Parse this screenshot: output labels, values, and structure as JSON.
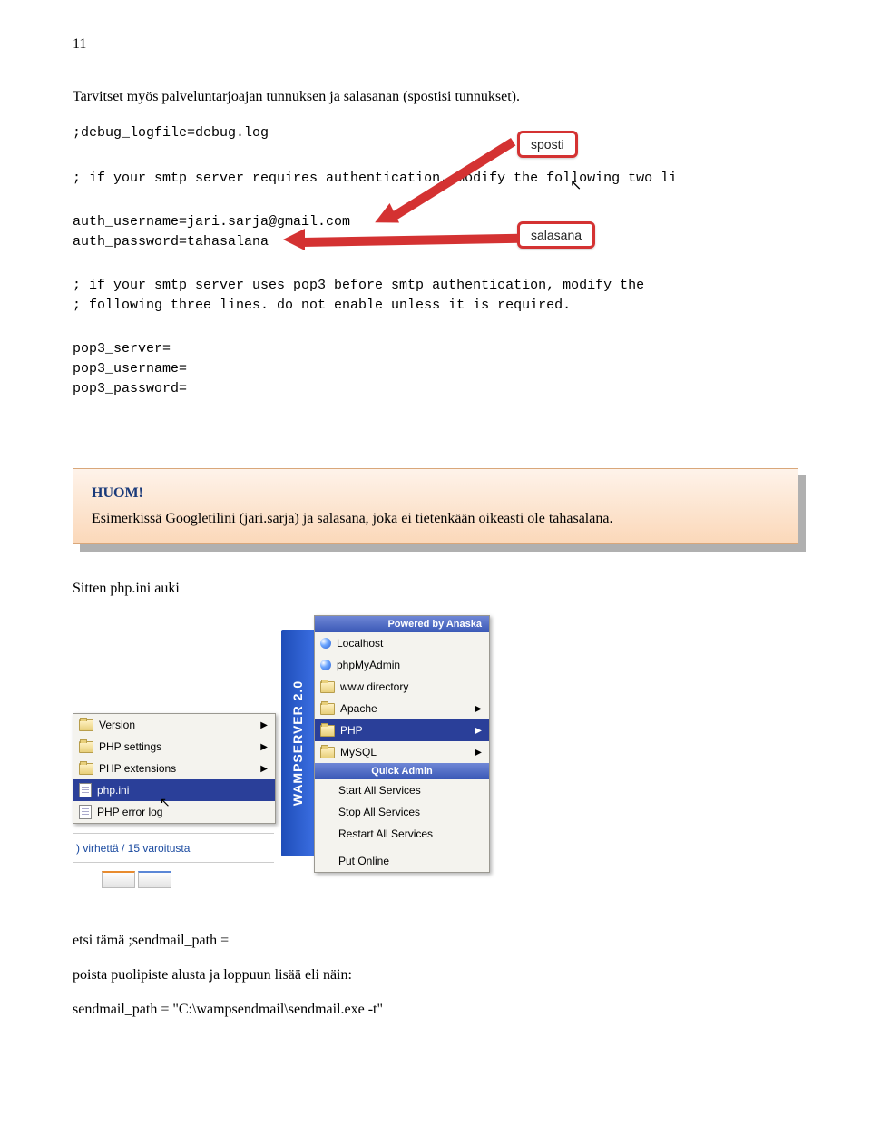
{
  "page_number": "11",
  "intro_text": "Tarvitset myös palveluntarjoajan tunnuksen ja salasanan (spostisi tunnukset).",
  "code": {
    "l1": ";debug_logfile=debug.log",
    "l2": "; if your smtp server requires authentication, modify the following two li",
    "l3": "auth_username=jari.sarja@gmail.com",
    "l4": "auth_password=tahasalana",
    "l5": "; if your smtp server uses pop3 before smtp authentication, modify the",
    "l6": "; following three lines.  do not enable unless it is required.",
    "l7": "pop3_server=",
    "l8": "pop3_username=",
    "l9": "pop3_password="
  },
  "callout1": "sposti",
  "callout2": "salasana",
  "note_heading": "HUOM!",
  "note_text": "Esimerkissä Googletilini (jari.sarja) ja salasana, joka ei tietenkään oikeasti ole tahasalana.",
  "sitten_text": "Sitten php.ini auki",
  "wamp": {
    "banner": "WAMPSERVER 2.0",
    "header": "Powered by Anaska",
    "items": {
      "localhost": "Localhost",
      "phpmyadmin": "phpMyAdmin",
      "wwwdir": "www directory",
      "apache": "Apache",
      "php": "PHP",
      "mysql": "MySQL"
    },
    "section": "Quick Admin",
    "admin": {
      "start": "Start All Services",
      "stop": "Stop All Services",
      "restart": "Restart All Services",
      "online": "Put Online"
    },
    "left": {
      "version": "Version",
      "settings": "PHP settings",
      "ext": "PHP extensions",
      "ini": "php.ini",
      "errorlog": "PHP error log"
    },
    "status": ") virhettä / 15 varoitusta"
  },
  "outro1": "etsi tämä ;sendmail_path =",
  "outro2": "poista puolipiste alusta ja loppuun lisää eli näin:",
  "outro3": "sendmail_path = \"C:\\wampsendmail\\sendmail.exe -t\""
}
